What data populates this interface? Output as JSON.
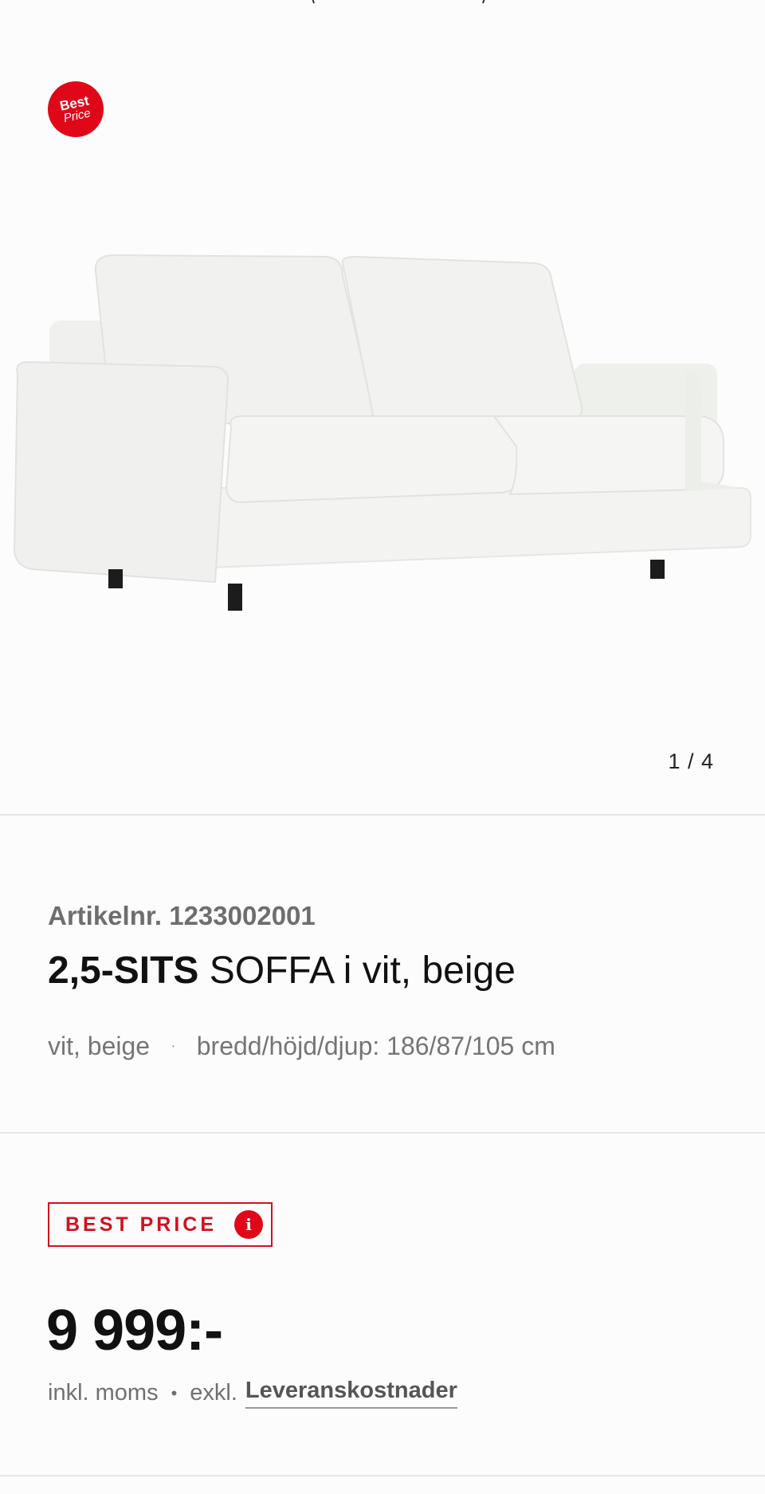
{
  "gallery": {
    "badge_line1": "Best",
    "badge_line2": "Price",
    "counter": "1 / 4"
  },
  "product": {
    "article_label": "Artikelnr. 1233002001",
    "title_bold": "2,5-SITS",
    "title_rest": " SOFFA i vit, beige",
    "color": "vit, beige",
    "dimensions": "bredd/höjd/djup: 186/87/105 cm"
  },
  "pricing": {
    "badge_text": "BEST PRICE",
    "info_icon_glyph": "i",
    "price": "9 999:-",
    "incl": "inkl. moms",
    "excl": "exkl.",
    "delivery_link": "Leveranskostnader"
  },
  "colors": {
    "accent": "#e00818",
    "text": "#111111",
    "muted": "#757575"
  }
}
